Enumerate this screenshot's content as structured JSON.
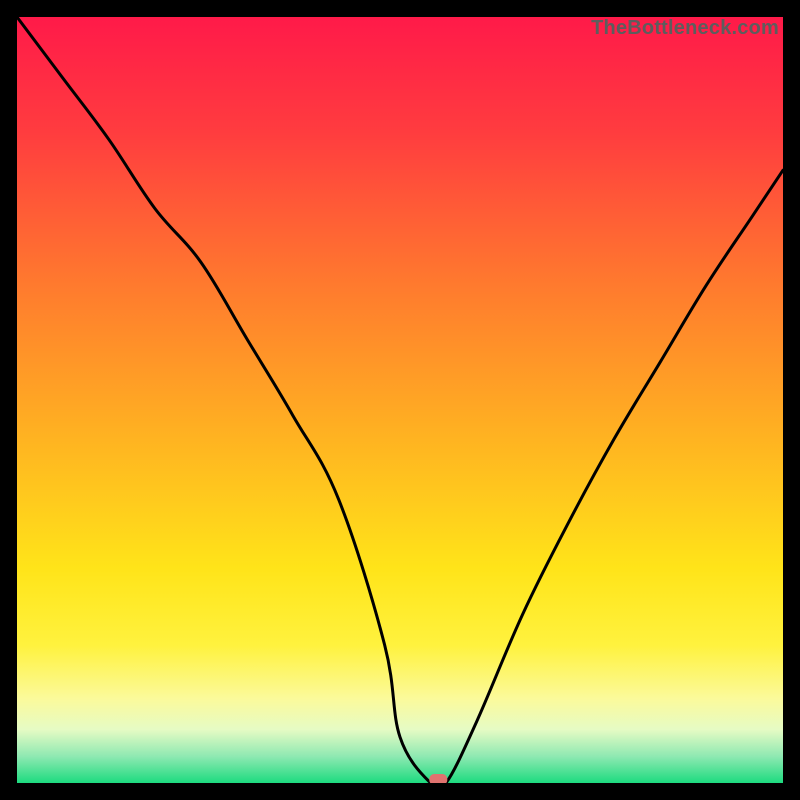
{
  "watermark": "TheBottleneck.com",
  "chart_data": {
    "type": "line",
    "title": "",
    "xlabel": "",
    "ylabel": "",
    "xlim": [
      0,
      100
    ],
    "ylim": [
      0,
      100
    ],
    "grid": false,
    "legend": false,
    "x": [
      0,
      6,
      12,
      18,
      24,
      30,
      36,
      42,
      48,
      50,
      54,
      56,
      60,
      66,
      72,
      78,
      84,
      90,
      96,
      100
    ],
    "values": [
      100,
      92,
      84,
      75,
      68,
      58,
      48,
      37,
      18,
      6,
      0,
      0,
      8,
      22,
      34,
      45,
      55,
      65,
      74,
      80
    ],
    "minimum_marker": {
      "x": 55,
      "y": 0
    },
    "background_gradient": {
      "stops": [
        {
          "offset": 0.0,
          "color": "#ff1a49"
        },
        {
          "offset": 0.15,
          "color": "#ff3c3f"
        },
        {
          "offset": 0.35,
          "color": "#ff7a2e"
        },
        {
          "offset": 0.55,
          "color": "#ffb321"
        },
        {
          "offset": 0.72,
          "color": "#ffe419"
        },
        {
          "offset": 0.82,
          "color": "#fff23e"
        },
        {
          "offset": 0.89,
          "color": "#fbfa9b"
        },
        {
          "offset": 0.93,
          "color": "#e6fbc4"
        },
        {
          "offset": 0.965,
          "color": "#8fe9b2"
        },
        {
          "offset": 1.0,
          "color": "#1ddb7f"
        }
      ]
    }
  }
}
